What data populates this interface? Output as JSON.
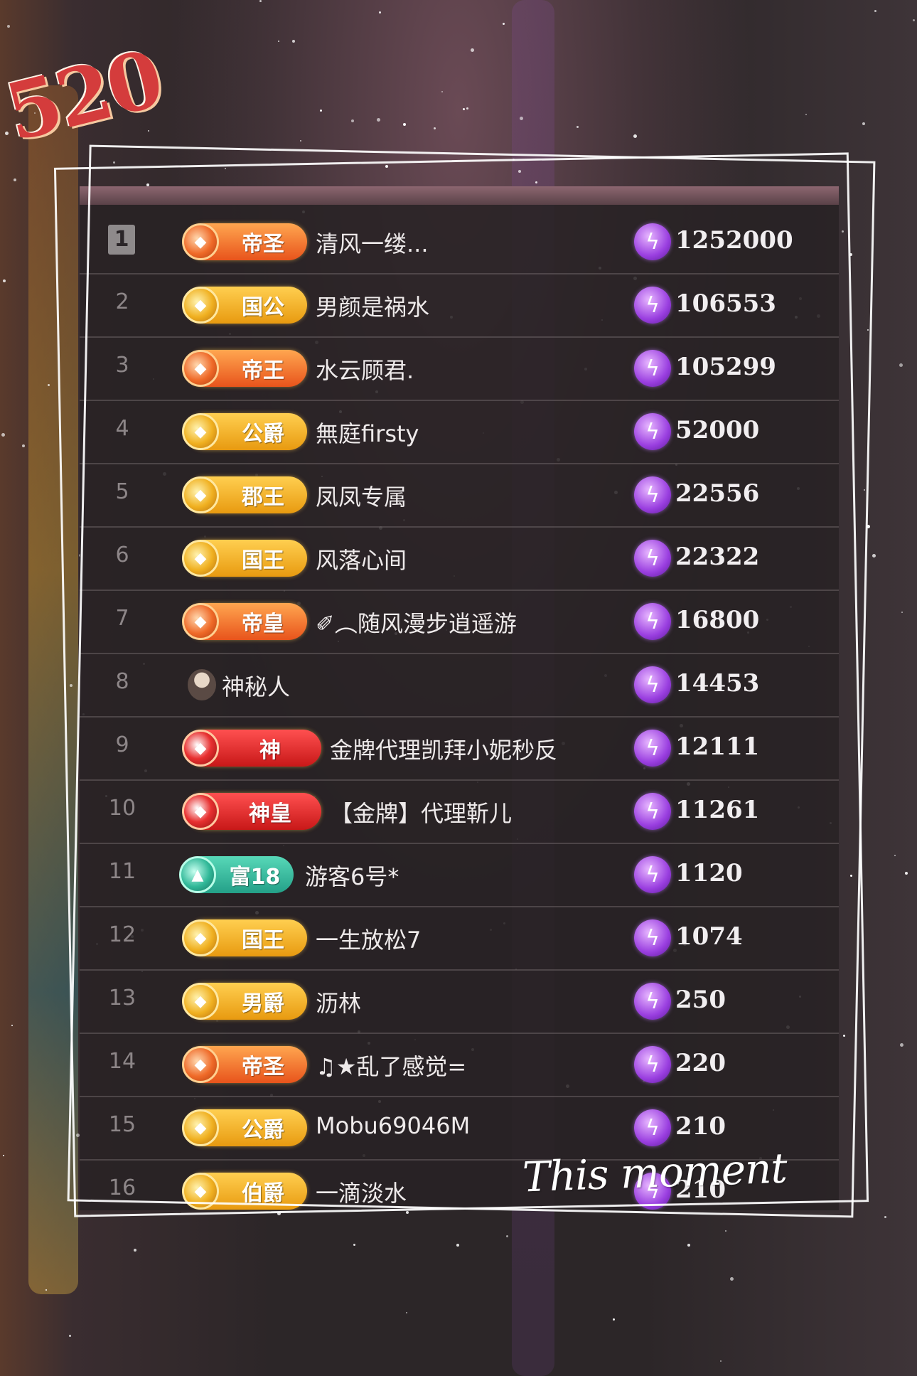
{
  "logo_text": "520",
  "caption": "This moment",
  "colors": {
    "accent_orange": "#e8541c",
    "accent_gold": "#e89a10",
    "accent_red": "#c81818",
    "accent_teal": "#24a088",
    "bolt_purple": "#9a3fe0"
  },
  "rows": [
    {
      "rank": "1",
      "badge": "帝圣",
      "badge_style": "orange",
      "name": "清风一缕...",
      "score": "1252000"
    },
    {
      "rank": "2",
      "badge": "国公",
      "badge_style": "gold",
      "name": "男颜是祸水",
      "score": "106553"
    },
    {
      "rank": "3",
      "badge": "帝王",
      "badge_style": "orange",
      "name": "水云顾君.",
      "score": "105299"
    },
    {
      "rank": "4",
      "badge": "公爵",
      "badge_style": "gold",
      "name": "無庭firsty",
      "score": "52000"
    },
    {
      "rank": "5",
      "badge": "郡王",
      "badge_style": "gold",
      "name": "凤凤专属",
      "score": "22556"
    },
    {
      "rank": "6",
      "badge": "国王",
      "badge_style": "gold",
      "name": "风落心间",
      "score": "22322"
    },
    {
      "rank": "7",
      "badge": "帝皇",
      "badge_style": "orange",
      "name": "✐︵随风漫步逍遥游",
      "score": "16800"
    },
    {
      "rank": "8",
      "badge": "",
      "badge_style": "none",
      "name": "神秘人",
      "score": "14453"
    },
    {
      "rank": "9",
      "badge": "神",
      "badge_style": "red",
      "name": "金牌代理凯拜小妮秒反",
      "score": "12111"
    },
    {
      "rank": "10",
      "badge": "神皇",
      "badge_style": "red",
      "name": "【金牌】代理靳儿",
      "score": "11261"
    },
    {
      "rank": "11",
      "badge": "富18",
      "badge_style": "teal",
      "name": "游客6号*",
      "score": "1120"
    },
    {
      "rank": "12",
      "badge": "国王",
      "badge_style": "gold",
      "name": "一生放松7",
      "score": "1074"
    },
    {
      "rank": "13",
      "badge": "男爵",
      "badge_style": "gold",
      "name": "沥林",
      "score": "250"
    },
    {
      "rank": "14",
      "badge": "帝圣",
      "badge_style": "orange",
      "name": "♫★乱了感觉=",
      "score": "220"
    },
    {
      "rank": "15",
      "badge": "公爵",
      "badge_style": "gold",
      "name": "Mobu69046M",
      "score": "210"
    },
    {
      "rank": "16",
      "badge": "伯爵",
      "badge_style": "gold",
      "name": "一滴淡水",
      "score": "210"
    }
  ]
}
